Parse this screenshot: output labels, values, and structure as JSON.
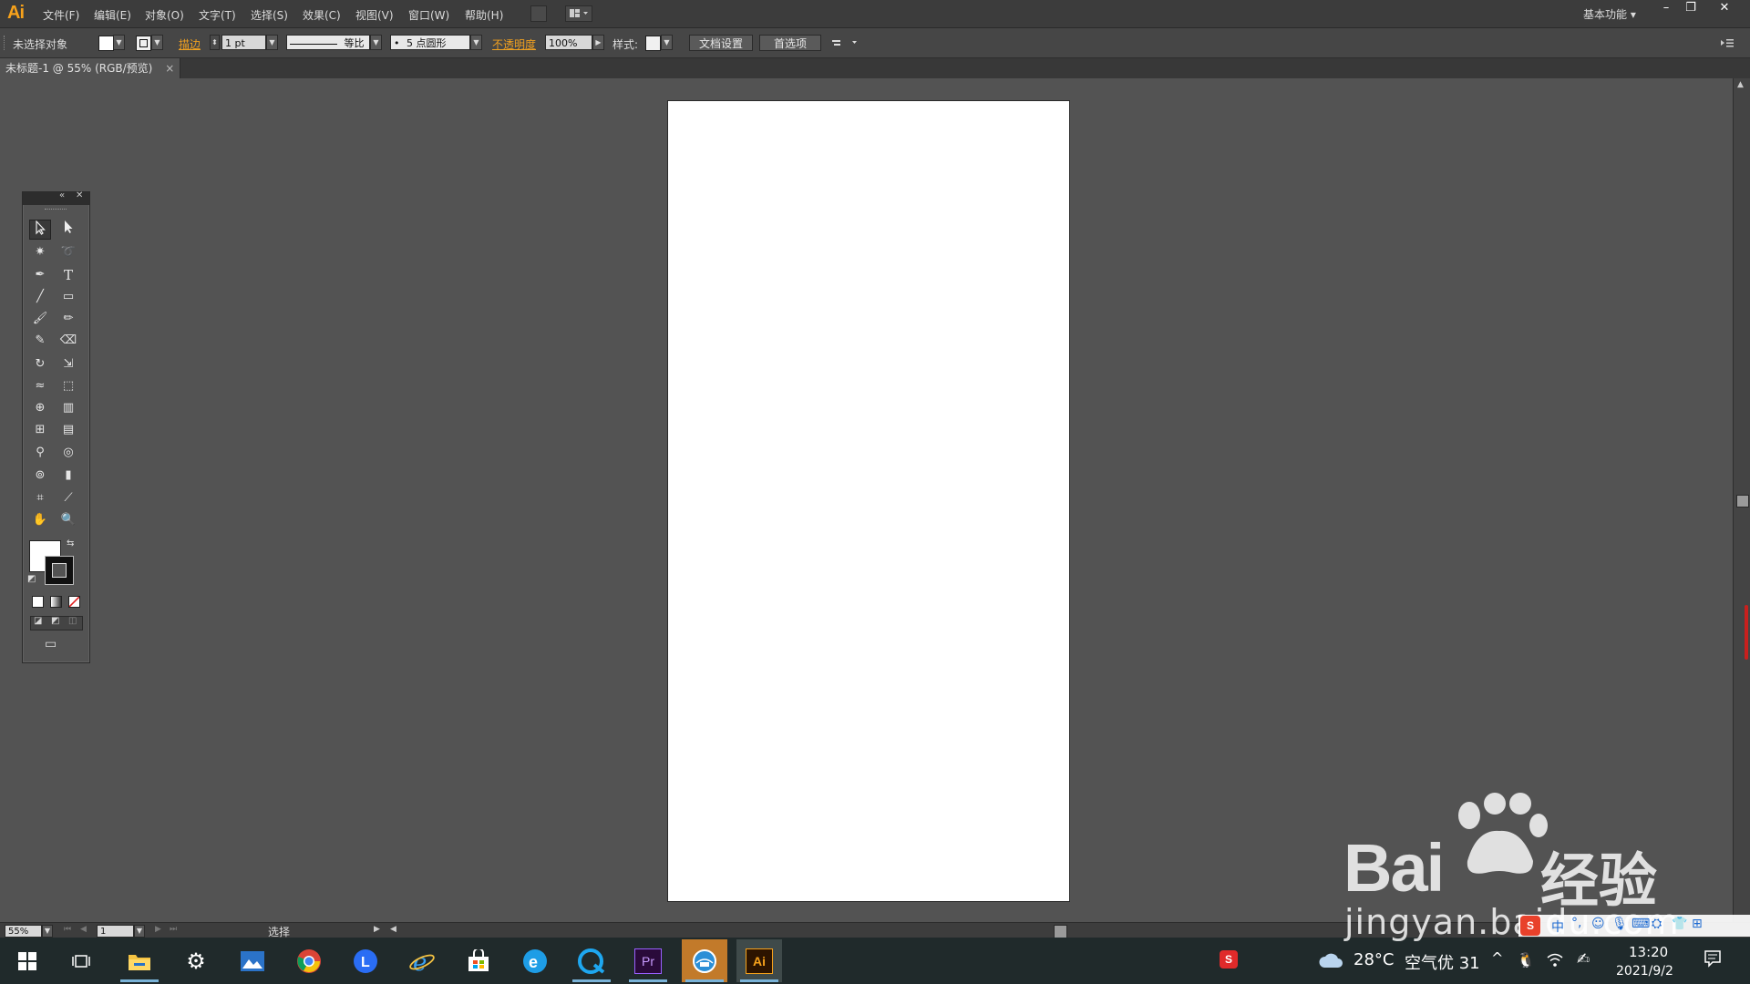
{
  "app": {
    "logo": "Ai"
  },
  "menu": {
    "items": [
      "文件(F)",
      "编辑(E)",
      "对象(O)",
      "文字(T)",
      "选择(S)",
      "效果(C)",
      "视图(V)",
      "窗口(W)",
      "帮助(H)"
    ],
    "workspace": "基本功能"
  },
  "control_bar": {
    "selection_status": "未选择对象",
    "stroke_label": "描边",
    "stroke_weight": "1 pt",
    "stroke_profile": "等比",
    "brush": "5 点圆形",
    "opacity_label": "不透明度",
    "opacity_value": "100%",
    "style_label": "样式:",
    "doc_setup_button": "文档设置",
    "preferences_button": "首选项"
  },
  "document_tab": {
    "title": "未标题-1 @ 55% (RGB/预览)",
    "close": "×"
  },
  "status_bar": {
    "zoom": "55%",
    "page": "1",
    "tool_name": "选择"
  },
  "taskbar": {
    "weather_temp": "28°C",
    "air_quality": "空气优 31",
    "time": "13:20",
    "date": "2021/9/2",
    "premiere_label": "Pr",
    "illustrator_label": "Ai"
  },
  "watermark": {
    "brand": "Bai",
    "brand_suffix": "经验",
    "url": "jingyan.baidu.com"
  },
  "colors": {
    "accent": "#f7a21b",
    "canvas": "#535353",
    "artboard": "#ffffff",
    "taskbar": "#202a2b"
  }
}
